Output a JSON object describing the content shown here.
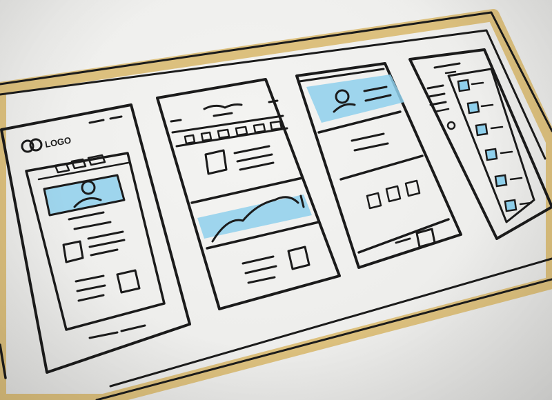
{
  "photo": {
    "subject": "",
    "colors": {
      "paper": "#f2f2f0",
      "ink": "#1b1b1b",
      "marker_gold": "#d8b76a",
      "marker_blue": "#8fd0ec"
    }
  },
  "sketch": {
    "logo_text": "LOGO",
    "panels": [
      {
        "id": "mockup-1"
      },
      {
        "id": "mockup-2"
      },
      {
        "id": "mockup-3"
      },
      {
        "id": "mockup-4"
      }
    ]
  }
}
